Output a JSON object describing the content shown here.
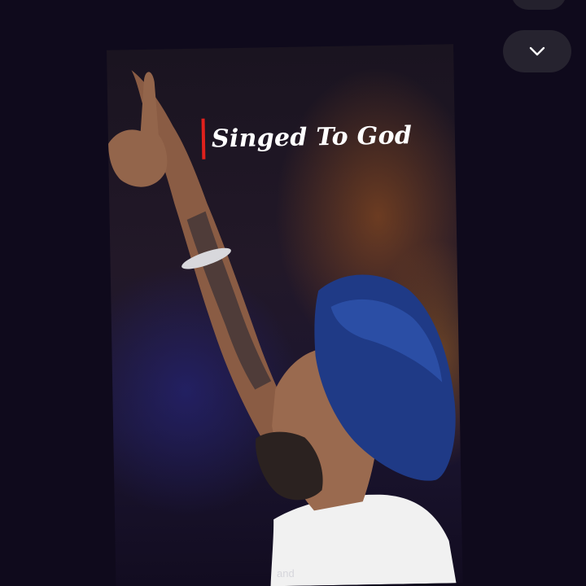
{
  "header": {
    "collapse_icon": "chevron-down-icon"
  },
  "video": {
    "caption": "Singed To God",
    "caption_bar_color": "#e0211c",
    "subtitle_fragment": "and"
  },
  "colors": {
    "background": "#0f0a1c",
    "button": "#26232f"
  }
}
